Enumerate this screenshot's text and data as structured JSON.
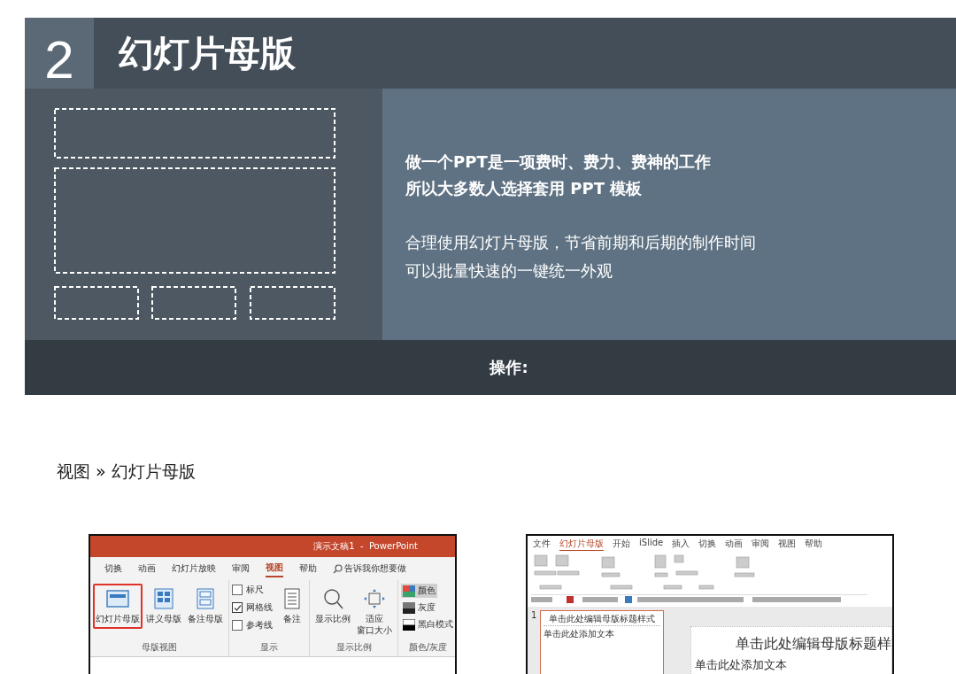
{
  "banner": {
    "number": "2",
    "title": "幻灯片母版",
    "emphasis_lines": [
      "做一个PPT是一项费时、费力、费神的工作",
      "所以大多数人选择套用 PPT 模板"
    ],
    "body_lines": [
      "合理使用幻灯片母版，节省前期和后期的制作时间",
      "可以批量快速的一键统一外观"
    ],
    "footer": "操作:"
  },
  "breadcrumb": "视图 » 幻灯片母版",
  "screenshot_1": {
    "window_title": "演示文稿1  -  PowerPoint",
    "tabs": [
      {
        "label": "切换",
        "selected": false
      },
      {
        "label": "动画",
        "selected": false
      },
      {
        "label": "幻灯片放映",
        "selected": false
      },
      {
        "label": "审阅",
        "selected": false
      },
      {
        "label": "视图",
        "selected": true
      },
      {
        "label": "帮助",
        "selected": false
      }
    ],
    "search_hint": "告诉我你想要做",
    "groups": [
      {
        "label": "母版视图",
        "items": [
          {
            "kind": "large",
            "label_lines": [
              "幻灯片母版"
            ],
            "selected": true
          },
          {
            "kind": "large",
            "label_lines": [
              "讲义母版"
            ],
            "selected": false
          },
          {
            "kind": "large",
            "label_lines": [
              "备注母版"
            ],
            "selected": false
          }
        ]
      },
      {
        "label": "显示",
        "items": [
          {
            "kind": "check",
            "label": "标尺",
            "checked": false
          },
          {
            "kind": "check",
            "label": "网格线",
            "checked": true
          },
          {
            "kind": "check",
            "label": "参考线",
            "checked": false
          },
          {
            "kind": "large",
            "label_lines": [
              "备注"
            ],
            "selected": false
          }
        ]
      },
      {
        "label": "显示比例",
        "items": [
          {
            "kind": "large",
            "label_lines": [
              "显示比例"
            ],
            "selected": false
          },
          {
            "kind": "large",
            "label_lines": [
              "适应",
              "窗口大小"
            ],
            "selected": false
          }
        ]
      },
      {
        "label": "颜色/灰度",
        "items": [
          {
            "kind": "small",
            "label": "颜色",
            "selected": true
          },
          {
            "kind": "small",
            "label": "灰度",
            "selected": false
          },
          {
            "kind": "small",
            "label": "黑白模式",
            "selected": false
          }
        ]
      }
    ]
  },
  "screenshot_2": {
    "tabs": [
      {
        "label": "文件",
        "selected": false
      },
      {
        "label": "幻灯片母版",
        "selected": true
      },
      {
        "label": "开始",
        "selected": false
      },
      {
        "label": "iSlide",
        "selected": false
      },
      {
        "label": "插入",
        "selected": false
      },
      {
        "label": "切换",
        "selected": false
      },
      {
        "label": "动画",
        "selected": false
      },
      {
        "label": "审阅",
        "selected": false
      },
      {
        "label": "视图",
        "selected": false
      },
      {
        "label": "帮助",
        "selected": false
      }
    ],
    "thumbnail_number": "1",
    "thumbnail_title": "单击此处编辑母版标题样式",
    "thumbnail_body": "单击此处添加文本",
    "slide_title": "单击此处编辑母版标题样",
    "slide_body": "单击此处添加文本"
  }
}
